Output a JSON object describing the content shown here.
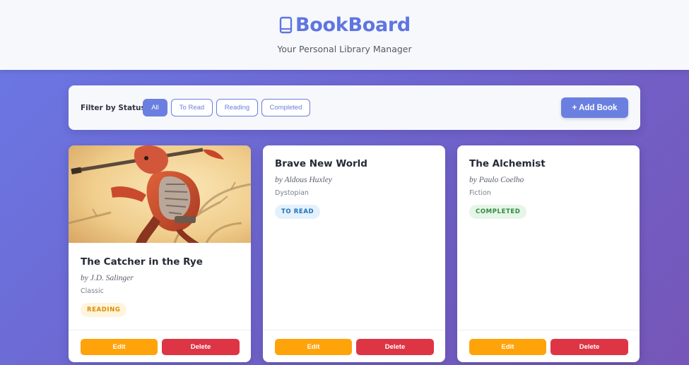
{
  "header": {
    "icon": "book-icon",
    "title": "BookBoard",
    "tagline": "Your Personal Library Manager"
  },
  "filter": {
    "label": "Filter by Status:",
    "chips": [
      "All",
      "To Read",
      "Reading",
      "Completed"
    ],
    "active": "All",
    "add_button": "+ Add Book"
  },
  "colors": {
    "accent": "#6a7fe0",
    "edit": "#ffa30a",
    "delete": "#de3545"
  },
  "books": [
    {
      "title": "The Catcher in the Rye",
      "author": "by J.D. Salinger",
      "genre": "Classic",
      "status": "READING",
      "has_cover": true,
      "edit": "Edit",
      "delete": "Delete"
    },
    {
      "title": "Brave New World",
      "author": "by Aldous Huxley",
      "genre": "Dystopian",
      "status": "TO READ",
      "has_cover": false,
      "edit": "Edit",
      "delete": "Delete"
    },
    {
      "title": "The Alchemist",
      "author": "by Paulo Coelho",
      "genre": "Fiction",
      "status": "COMPLETED",
      "has_cover": false,
      "edit": "Edit",
      "delete": "Delete"
    }
  ]
}
